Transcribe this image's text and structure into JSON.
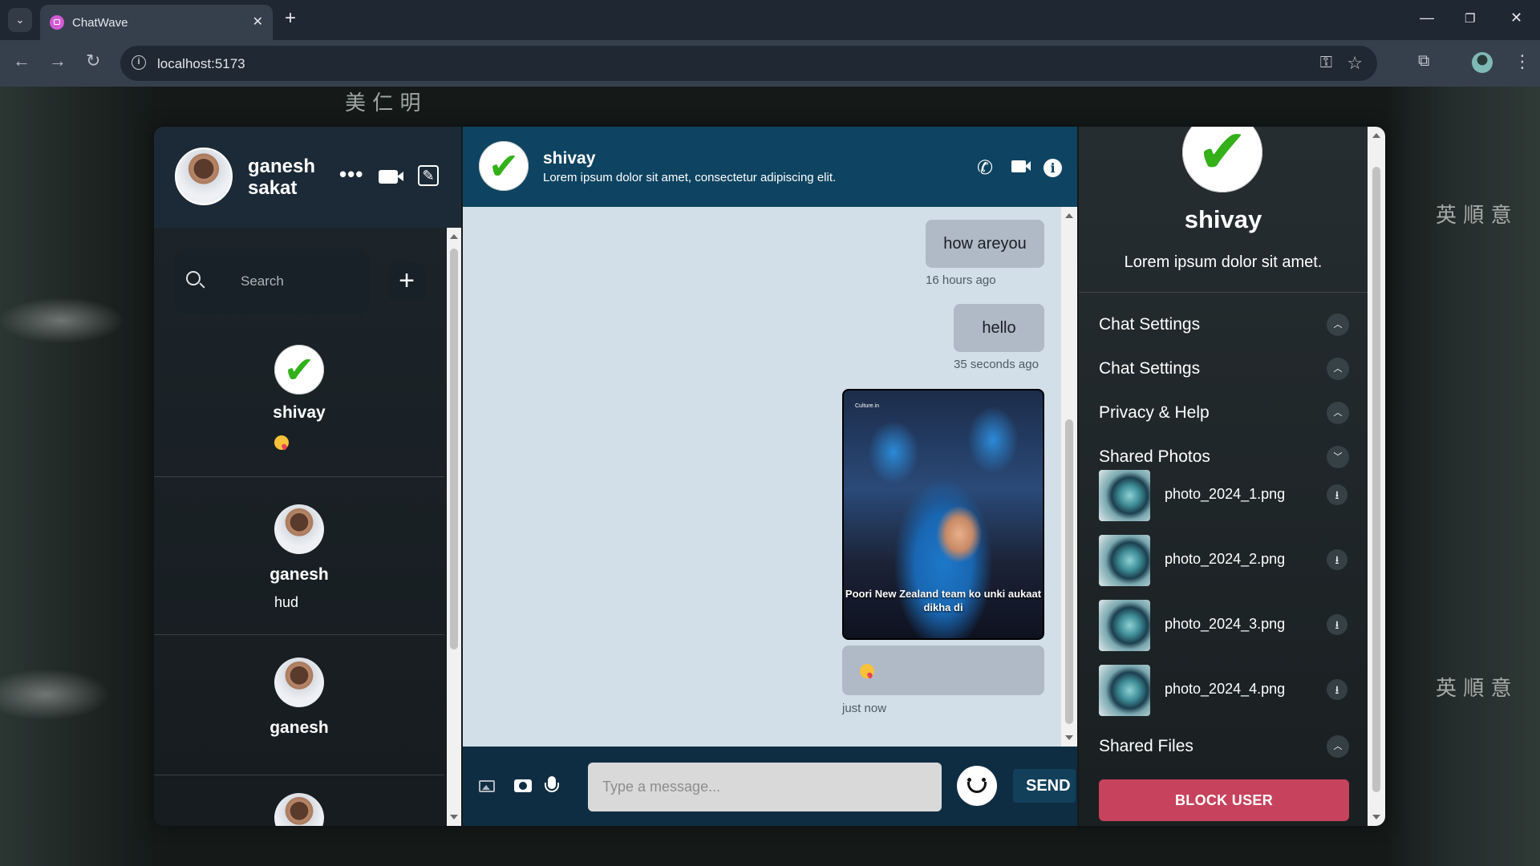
{
  "browser": {
    "tab_title": "ChatWave",
    "url": "localhost:5173"
  },
  "background_signs": [
    "美 仁 明",
    "英 順 意",
    "英 順 意"
  ],
  "sidebar": {
    "me": {
      "name": "ganesh sakat"
    },
    "search": {
      "placeholder": "Search"
    },
    "contacts": [
      {
        "name": "shivay",
        "last_message_icon": "kiss-emoji",
        "avatar": "check-icon"
      },
      {
        "name": "ganesh",
        "last_message": "hud",
        "avatar": "user-photo"
      },
      {
        "name": "ganesh",
        "last_message": "",
        "avatar": "user-photo"
      }
    ]
  },
  "chat": {
    "contact_name": "shivay",
    "contact_status": "Lorem ipsum dolor sit amet, consectetur adipiscing elit.",
    "messages": [
      {
        "text": "how areyou",
        "time": "16 hours ago"
      },
      {
        "text": "hello",
        "time": "35 seconds ago"
      },
      {
        "image_caption": "Poori New Zealand team ko unki aukaat dikha di",
        "image_watermark": "Culture.in",
        "emoji": "kiss-emoji",
        "time": "just now"
      }
    ],
    "composer": {
      "placeholder": "Type a message...",
      "send_label": "SEND"
    }
  },
  "details": {
    "name": "shivay",
    "status": "Lorem ipsum dolor sit amet.",
    "sections": [
      {
        "title": "Chat Settings",
        "state": "collapsed"
      },
      {
        "title": "Chat Settings",
        "state": "collapsed"
      },
      {
        "title": "Privacy & Help",
        "state": "collapsed"
      },
      {
        "title": "Shared Photos",
        "state": "expanded"
      },
      {
        "title": "Shared Files",
        "state": "collapsed"
      }
    ],
    "shared_photos": [
      "photo_2024_1.png",
      "photo_2024_2.png",
      "photo_2024_3.png",
      "photo_2024_4.png"
    ],
    "block_label": "BLOCK USER"
  },
  "colors": {
    "chat_header": "#0e4461",
    "chat_background": "#d3dfe8",
    "bubble": "#b0b9c6",
    "block_button": "#c7435d",
    "check_mark": "#33b01a"
  }
}
